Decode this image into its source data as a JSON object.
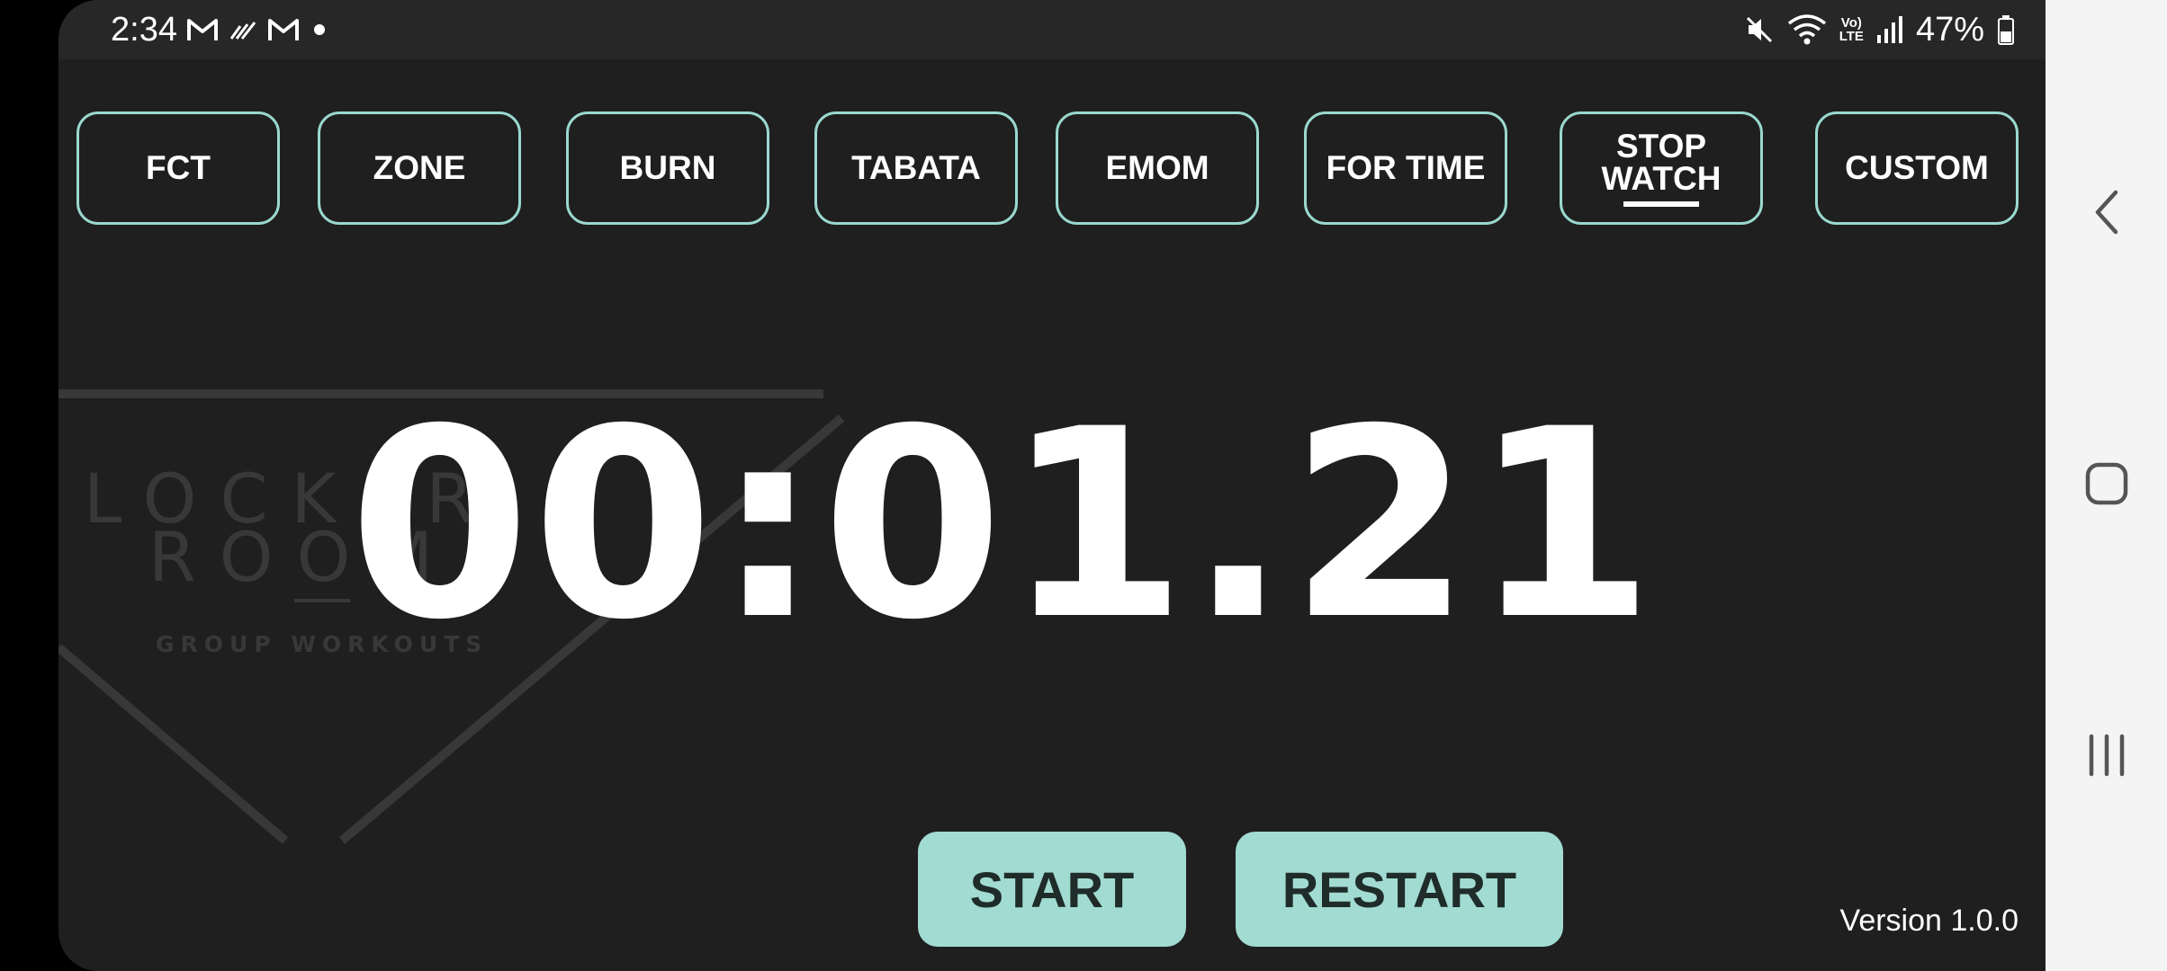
{
  "status_bar": {
    "time": "2:34",
    "battery": "47%",
    "notification_icons": [
      "gmail-icon",
      "missed-call-icon",
      "gmail-icon",
      "dot-icon"
    ],
    "system_icons": [
      "mute-icon",
      "wifi-icon",
      "volte-icon",
      "signal-icon",
      "battery-icon"
    ],
    "volte_top": "Vo)",
    "volte_bottom": "LTE"
  },
  "modes": [
    {
      "label": "FCT",
      "selected": false
    },
    {
      "label": "ZONE",
      "selected": false
    },
    {
      "label": "BURN",
      "selected": false
    },
    {
      "label": "TABATA",
      "selected": false
    },
    {
      "label": "EMOM",
      "selected": false
    },
    {
      "label": "FOR TIME",
      "selected": false
    },
    {
      "label_line1": "STOP",
      "label_line2": "WATCH",
      "selected": true
    },
    {
      "label": "CUSTOM",
      "selected": false
    }
  ],
  "logo": {
    "line1": "LOCKER",
    "line2": "ROOM",
    "tagline": "GROUP WORKOUTS"
  },
  "timer": {
    "display": "00:01.21"
  },
  "actions": {
    "start_label": "START",
    "restart_label": "RESTART"
  },
  "version": "Version 1.0.0",
  "colors": {
    "accent": "#a1dbd2",
    "tab_border": "#9ad8cf",
    "background": "#1f1f1f",
    "status_bar": "#272727",
    "nav_bar": "#f4f4f4"
  }
}
